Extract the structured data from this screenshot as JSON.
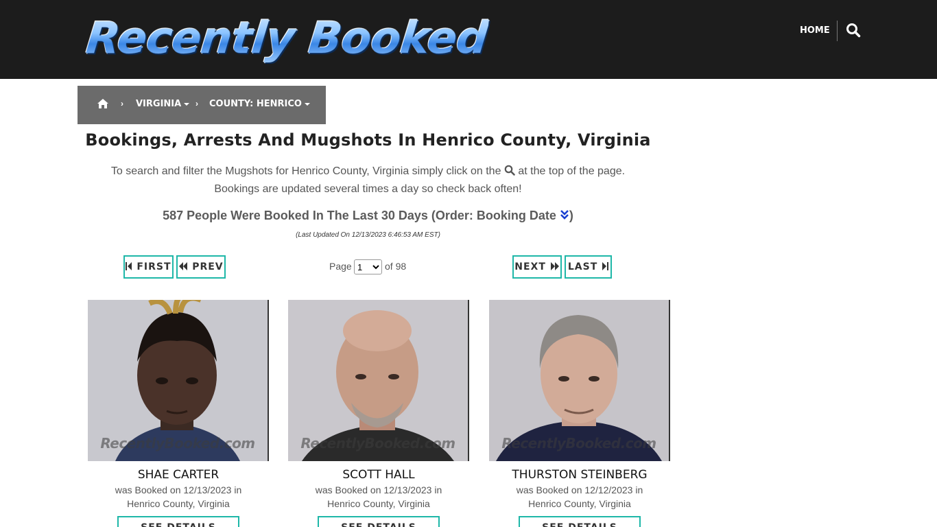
{
  "header": {
    "logo_text": "Recently Booked",
    "nav_home": "HOME"
  },
  "breadcrumb": {
    "state": "VIRGINIA",
    "county": "COUNTY: HENRICO"
  },
  "main": {
    "title": "Bookings, Arrests And Mugshots In Henrico County, Virginia",
    "intro_before": "To search and filter the Mugshots for Henrico County, Virginia simply click on the",
    "intro_after": "at the top of the page.",
    "intro_line2": "Bookings are updated several times a day so check back often!",
    "count_text": "587 People Were Booked In The Last 30 Days (Order: Booking Date",
    "count_close": ")",
    "last_updated": "(Last Updated On 12/13/2023 6:46:53 AM EST)"
  },
  "pager": {
    "first": "FIRST",
    "prev": "PREV",
    "next": "NEXT",
    "last": "LAST",
    "page_label": "Page",
    "page_value": "1",
    "of_text": "of 98"
  },
  "cards": [
    {
      "name": "SHAE CARTER",
      "line1": "was Booked on 12/13/2023 in",
      "line2": "Henrico County, Virginia",
      "watermark": "RecentlyBooked.com",
      "button": "SEE DETAILS"
    },
    {
      "name": "SCOTT HALL",
      "line1": "was Booked on 12/13/2023 in",
      "line2": "Henrico County, Virginia",
      "watermark": "RecentlyBooked.com",
      "button": "SEE DETAILS"
    },
    {
      "name": "THURSTON STEINBERG",
      "line1": "was Booked on 12/12/2023 in",
      "line2": "Henrico County, Virginia",
      "watermark": "RecentlyBooked.com",
      "button": "SEE DETAILS"
    }
  ],
  "colors": {
    "header_bg": "#1c1c1c",
    "breadcrumb_bg": "#6b6b6b",
    "accent_teal": "#1eb7a8",
    "order_icon_blue": "#1a3fd1"
  },
  "icons": {
    "search": "search-icon",
    "home": "home-icon",
    "order": "double-chevron-down-icon"
  }
}
